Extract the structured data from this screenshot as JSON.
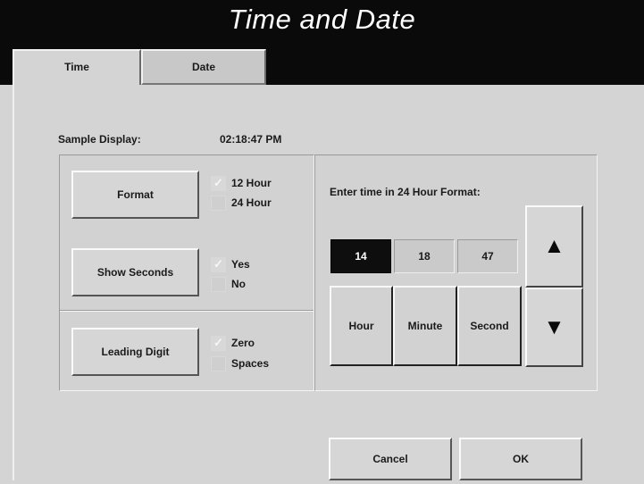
{
  "window": {
    "title": "Time and Date"
  },
  "tabs": [
    {
      "label": "Time",
      "active": true
    },
    {
      "label": "Date",
      "active": false
    }
  ],
  "sample": {
    "label": "Sample Display:",
    "value": "02:18:47 PM"
  },
  "format": {
    "button_label": "Format",
    "options": [
      {
        "label": "12 Hour",
        "checked": true
      },
      {
        "label": "24 Hour",
        "checked": false
      }
    ]
  },
  "show_seconds": {
    "button_label": "Show Seconds",
    "options": [
      {
        "label": "Yes",
        "checked": true
      },
      {
        "label": "No",
        "checked": false
      }
    ]
  },
  "leading_digit": {
    "button_label": "Leading Digit",
    "options": [
      {
        "label": "Zero",
        "checked": true
      },
      {
        "label": "Spaces",
        "checked": false
      }
    ]
  },
  "time_entry": {
    "instruction": "Enter time in 24 Hour Format:",
    "hour": "14",
    "minute": "18",
    "second": "47",
    "selected_field": "hour",
    "hour_label": "Hour",
    "minute_label": "Minute",
    "second_label": "Second",
    "up_icon": "up-triangle-icon",
    "down_icon": "down-triangle-icon"
  },
  "footer": {
    "cancel_label": "Cancel",
    "ok_label": "OK"
  },
  "check_glyph": "✓",
  "colors": {
    "titlebar": "#0a0a0a",
    "selected_field_bg": "#0e0e0e",
    "panel": "#d4d4d4"
  }
}
